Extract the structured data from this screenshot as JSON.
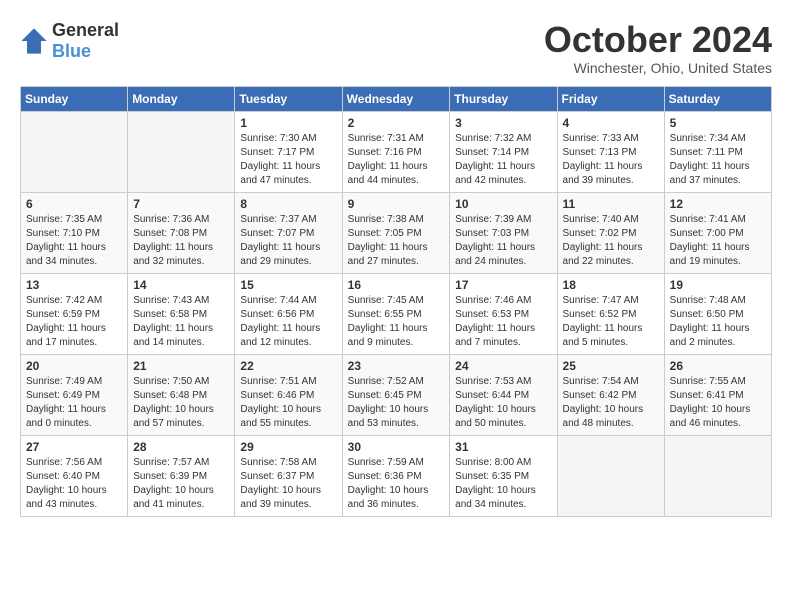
{
  "logo": {
    "general": "General",
    "blue": "Blue"
  },
  "header": {
    "month": "October 2024",
    "location": "Winchester, Ohio, United States"
  },
  "weekdays": [
    "Sunday",
    "Monday",
    "Tuesday",
    "Wednesday",
    "Thursday",
    "Friday",
    "Saturday"
  ],
  "weeks": [
    [
      {
        "day": "",
        "sunrise": "",
        "sunset": "",
        "daylight": ""
      },
      {
        "day": "",
        "sunrise": "",
        "sunset": "",
        "daylight": ""
      },
      {
        "day": "1",
        "sunrise": "Sunrise: 7:30 AM",
        "sunset": "Sunset: 7:17 PM",
        "daylight": "Daylight: 11 hours and 47 minutes."
      },
      {
        "day": "2",
        "sunrise": "Sunrise: 7:31 AM",
        "sunset": "Sunset: 7:16 PM",
        "daylight": "Daylight: 11 hours and 44 minutes."
      },
      {
        "day": "3",
        "sunrise": "Sunrise: 7:32 AM",
        "sunset": "Sunset: 7:14 PM",
        "daylight": "Daylight: 11 hours and 42 minutes."
      },
      {
        "day": "4",
        "sunrise": "Sunrise: 7:33 AM",
        "sunset": "Sunset: 7:13 PM",
        "daylight": "Daylight: 11 hours and 39 minutes."
      },
      {
        "day": "5",
        "sunrise": "Sunrise: 7:34 AM",
        "sunset": "Sunset: 7:11 PM",
        "daylight": "Daylight: 11 hours and 37 minutes."
      }
    ],
    [
      {
        "day": "6",
        "sunrise": "Sunrise: 7:35 AM",
        "sunset": "Sunset: 7:10 PM",
        "daylight": "Daylight: 11 hours and 34 minutes."
      },
      {
        "day": "7",
        "sunrise": "Sunrise: 7:36 AM",
        "sunset": "Sunset: 7:08 PM",
        "daylight": "Daylight: 11 hours and 32 minutes."
      },
      {
        "day": "8",
        "sunrise": "Sunrise: 7:37 AM",
        "sunset": "Sunset: 7:07 PM",
        "daylight": "Daylight: 11 hours and 29 minutes."
      },
      {
        "day": "9",
        "sunrise": "Sunrise: 7:38 AM",
        "sunset": "Sunset: 7:05 PM",
        "daylight": "Daylight: 11 hours and 27 minutes."
      },
      {
        "day": "10",
        "sunrise": "Sunrise: 7:39 AM",
        "sunset": "Sunset: 7:03 PM",
        "daylight": "Daylight: 11 hours and 24 minutes."
      },
      {
        "day": "11",
        "sunrise": "Sunrise: 7:40 AM",
        "sunset": "Sunset: 7:02 PM",
        "daylight": "Daylight: 11 hours and 22 minutes."
      },
      {
        "day": "12",
        "sunrise": "Sunrise: 7:41 AM",
        "sunset": "Sunset: 7:00 PM",
        "daylight": "Daylight: 11 hours and 19 minutes."
      }
    ],
    [
      {
        "day": "13",
        "sunrise": "Sunrise: 7:42 AM",
        "sunset": "Sunset: 6:59 PM",
        "daylight": "Daylight: 11 hours and 17 minutes."
      },
      {
        "day": "14",
        "sunrise": "Sunrise: 7:43 AM",
        "sunset": "Sunset: 6:58 PM",
        "daylight": "Daylight: 11 hours and 14 minutes."
      },
      {
        "day": "15",
        "sunrise": "Sunrise: 7:44 AM",
        "sunset": "Sunset: 6:56 PM",
        "daylight": "Daylight: 11 hours and 12 minutes."
      },
      {
        "day": "16",
        "sunrise": "Sunrise: 7:45 AM",
        "sunset": "Sunset: 6:55 PM",
        "daylight": "Daylight: 11 hours and 9 minutes."
      },
      {
        "day": "17",
        "sunrise": "Sunrise: 7:46 AM",
        "sunset": "Sunset: 6:53 PM",
        "daylight": "Daylight: 11 hours and 7 minutes."
      },
      {
        "day": "18",
        "sunrise": "Sunrise: 7:47 AM",
        "sunset": "Sunset: 6:52 PM",
        "daylight": "Daylight: 11 hours and 5 minutes."
      },
      {
        "day": "19",
        "sunrise": "Sunrise: 7:48 AM",
        "sunset": "Sunset: 6:50 PM",
        "daylight": "Daylight: 11 hours and 2 minutes."
      }
    ],
    [
      {
        "day": "20",
        "sunrise": "Sunrise: 7:49 AM",
        "sunset": "Sunset: 6:49 PM",
        "daylight": "Daylight: 11 hours and 0 minutes."
      },
      {
        "day": "21",
        "sunrise": "Sunrise: 7:50 AM",
        "sunset": "Sunset: 6:48 PM",
        "daylight": "Daylight: 10 hours and 57 minutes."
      },
      {
        "day": "22",
        "sunrise": "Sunrise: 7:51 AM",
        "sunset": "Sunset: 6:46 PM",
        "daylight": "Daylight: 10 hours and 55 minutes."
      },
      {
        "day": "23",
        "sunrise": "Sunrise: 7:52 AM",
        "sunset": "Sunset: 6:45 PM",
        "daylight": "Daylight: 10 hours and 53 minutes."
      },
      {
        "day": "24",
        "sunrise": "Sunrise: 7:53 AM",
        "sunset": "Sunset: 6:44 PM",
        "daylight": "Daylight: 10 hours and 50 minutes."
      },
      {
        "day": "25",
        "sunrise": "Sunrise: 7:54 AM",
        "sunset": "Sunset: 6:42 PM",
        "daylight": "Daylight: 10 hours and 48 minutes."
      },
      {
        "day": "26",
        "sunrise": "Sunrise: 7:55 AM",
        "sunset": "Sunset: 6:41 PM",
        "daylight": "Daylight: 10 hours and 46 minutes."
      }
    ],
    [
      {
        "day": "27",
        "sunrise": "Sunrise: 7:56 AM",
        "sunset": "Sunset: 6:40 PM",
        "daylight": "Daylight: 10 hours and 43 minutes."
      },
      {
        "day": "28",
        "sunrise": "Sunrise: 7:57 AM",
        "sunset": "Sunset: 6:39 PM",
        "daylight": "Daylight: 10 hours and 41 minutes."
      },
      {
        "day": "29",
        "sunrise": "Sunrise: 7:58 AM",
        "sunset": "Sunset: 6:37 PM",
        "daylight": "Daylight: 10 hours and 39 minutes."
      },
      {
        "day": "30",
        "sunrise": "Sunrise: 7:59 AM",
        "sunset": "Sunset: 6:36 PM",
        "daylight": "Daylight: 10 hours and 36 minutes."
      },
      {
        "day": "31",
        "sunrise": "Sunrise: 8:00 AM",
        "sunset": "Sunset: 6:35 PM",
        "daylight": "Daylight: 10 hours and 34 minutes."
      },
      {
        "day": "",
        "sunrise": "",
        "sunset": "",
        "daylight": ""
      },
      {
        "day": "",
        "sunrise": "",
        "sunset": "",
        "daylight": ""
      }
    ]
  ]
}
